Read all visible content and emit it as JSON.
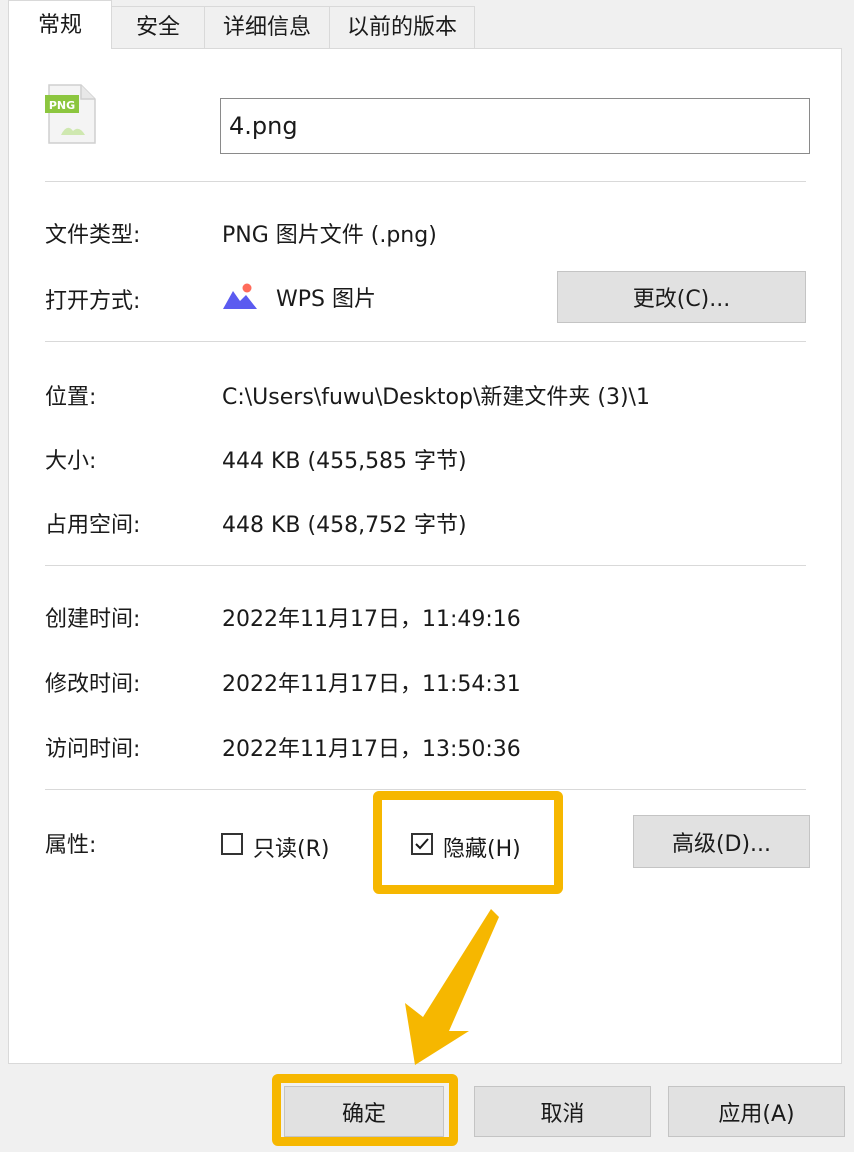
{
  "tabs": [
    {
      "label": "常规",
      "active": true
    },
    {
      "label": "安全",
      "active": false
    },
    {
      "label": "详细信息",
      "active": false
    },
    {
      "label": "以前的版本",
      "active": false
    }
  ],
  "file": {
    "icon": "png-file-icon",
    "icon_text": "PNG",
    "name": "4.png"
  },
  "type": {
    "label": "文件类型:",
    "value": "PNG 图片文件 (.png)"
  },
  "open_with": {
    "label": "打开方式:",
    "app_icon": "wps-picture-icon",
    "app": "WPS 图片",
    "change_button": "更改(C)..."
  },
  "location": {
    "label": "位置:",
    "value": "C:\\Users\\fuwu\\Desktop\\新建文件夹 (3)\\1"
  },
  "size": {
    "label": "大小:",
    "value": "444 KB (455,585 字节)"
  },
  "size_on_disk": {
    "label": "占用空间:",
    "value": "448 KB (458,752 字节)"
  },
  "created": {
    "label": "创建时间:",
    "value": "2022年11月17日，11:49:16"
  },
  "modified": {
    "label": "修改时间:",
    "value": "2022年11月17日，11:54:31"
  },
  "accessed": {
    "label": "访问时间:",
    "value": "2022年11月17日，13:50:36"
  },
  "attributes": {
    "label": "属性:",
    "readonly": {
      "label": "只读(R)",
      "checked": false
    },
    "hidden": {
      "label": "隐藏(H)",
      "checked": true
    },
    "advanced_button": "高级(D)..."
  },
  "footer": {
    "ok": "确定",
    "cancel": "取消",
    "apply": "应用(A)"
  },
  "colors": {
    "highlight": "#f6b700",
    "arrow": "#f6b700"
  }
}
